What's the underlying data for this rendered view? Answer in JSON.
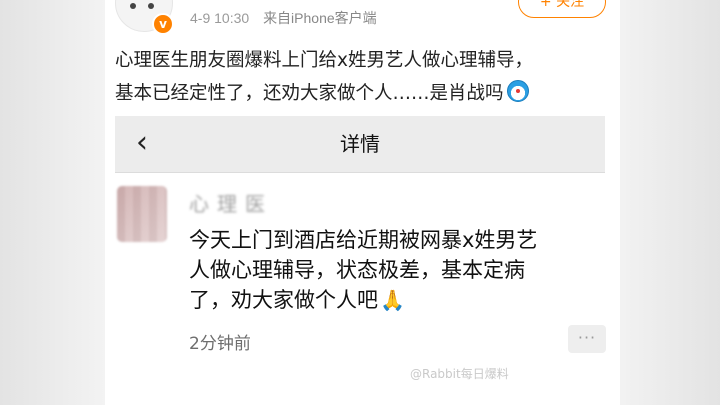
{
  "post": {
    "timestamp": "4-9 10:30",
    "source": "来自iPhone客户端",
    "follow_label": "+ 关注",
    "text_lines": [
      "心理医生朋友圈爆料上门给x姓男艺人做心理辅导，",
      "基本已经定性了，还劝大家做个人……是肖战吗"
    ]
  },
  "inner_screen": {
    "nav_title": "详情",
    "comment": {
      "author_blurred": "心理医",
      "lines": [
        "今天上门到酒店给近期被网暴x姓男艺",
        "人做心理辅导，状态极差，基本定病",
        "了，劝大家做个人吧"
      ],
      "time": "2分钟前"
    }
  },
  "watermark": "@Rabbit每日爆料",
  "icons": {
    "vip_badge": "v",
    "back": "‹",
    "more": "···",
    "pray_emoji": "🙏"
  }
}
